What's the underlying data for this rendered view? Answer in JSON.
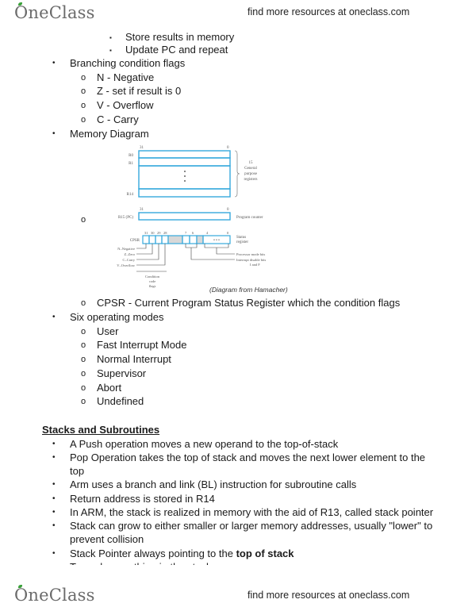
{
  "header": {
    "logo_text": "OneClass",
    "promo_text": "find more resources at oneclass.com"
  },
  "footer": {
    "logo_text": "OneClass",
    "promo_text": "find more resources at oneclass.com"
  },
  "content": {
    "cut_sub_item": "Store results in memory",
    "sub_item_update": "Update PC and repeat",
    "branching": {
      "label": "Branching condition flags",
      "items": [
        "N - Negative",
        "Z - set if result is 0",
        "V - Overflow",
        "C - Carry"
      ]
    },
    "memory_diagram": {
      "label": "Memory Diagram",
      "diagram": {
        "bit_high": "31",
        "bit_low": "0",
        "registers": [
          "R0",
          "R1",
          "R14"
        ],
        "ellipsis": "⋮",
        "gp_note": [
          "15",
          "General",
          "purpose",
          "registers"
        ],
        "pc_label": "R15 (PC)",
        "pc_note": "Program counter",
        "cpsr_label": "CPSR",
        "cpsr_bits": [
          "31",
          "30",
          "29",
          "28",
          "7",
          "6",
          "4",
          "0"
        ],
        "cpsr_dots": "• • •",
        "status_note": [
          "Status",
          "register"
        ],
        "flags": [
          "N–Negative",
          "Z–Zero",
          "C–Carry",
          "V–Overflow"
        ],
        "mode_bits_note": "Processor mode bits",
        "interrupt_note": [
          "Interrupt disable bits",
          "I and F"
        ],
        "cond_note": [
          "Condition",
          "code",
          "flags"
        ],
        "caption": "(Diagram from Hamacher)"
      },
      "cpsr_item": "CPSR - Current Program Status Register which the condition flags"
    },
    "modes": {
      "label": "Six operating modes",
      "items": [
        "User",
        "Fast Interrupt Mode",
        "Normal Interrupt",
        "Supervisor",
        "Abort",
        "Undefined"
      ]
    },
    "stacks": {
      "heading": "Stacks and Subroutines",
      "items": [
        "A Push operation moves a new operand to the top-of-stack",
        "Pop Operation takes the top of stack and moves the next lower element to the",
        "top",
        "Arm uses a branch and link (BL) instruction for subroutine calls",
        "Return address is stored in R14",
        "In ARM, the stack is realized in memory with the aid of R13, called stack pointer",
        "Stack can grow to either smaller or larger memory addresses, usually \"lower\" to",
        "prevent collision"
      ],
      "pointer_item_prefix": "Stack Pointer always pointing to the ",
      "pointer_item_bold": "top of stack",
      "cut_item": "To push something in the stack"
    },
    "markers": {
      "bullet": "•",
      "circle": "o",
      "square": "▪"
    }
  }
}
